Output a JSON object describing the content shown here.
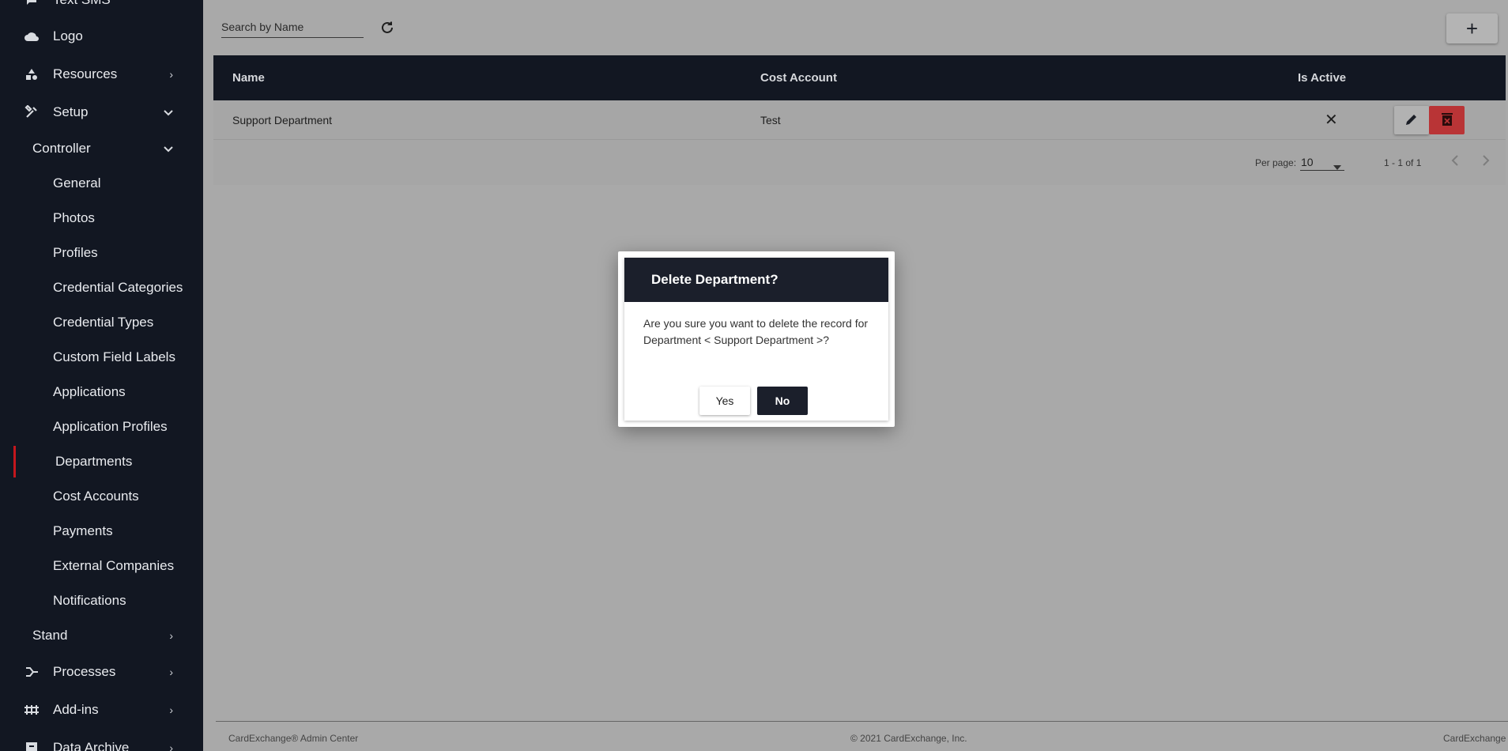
{
  "sidebar": {
    "items": [
      {
        "label": "Text SMS",
        "icon": "chat-icon"
      },
      {
        "label": "Logo",
        "icon": "cloud-icon"
      },
      {
        "label": "Resources",
        "icon": "shapes-icon",
        "chevron": "›"
      },
      {
        "label": "Setup",
        "icon": "tools-icon",
        "chevron": "⌄"
      },
      {
        "label": "Controller",
        "chevron": "⌄"
      },
      {
        "label": "General"
      },
      {
        "label": "Photos"
      },
      {
        "label": "Profiles"
      },
      {
        "label": "Credential Categories"
      },
      {
        "label": "Credential Types"
      },
      {
        "label": "Custom Field Labels"
      },
      {
        "label": "Applications"
      },
      {
        "label": "Application Profiles"
      },
      {
        "label": "Departments"
      },
      {
        "label": "Cost Accounts"
      },
      {
        "label": "Payments"
      },
      {
        "label": "External Companies"
      },
      {
        "label": "Notifications"
      },
      {
        "label": "Stand",
        "chevron": "›"
      },
      {
        "label": "Processes",
        "icon": "processes-icon",
        "chevron": "›"
      },
      {
        "label": "Add-ins",
        "icon": "addins-icon",
        "chevron": "›"
      },
      {
        "label": "Data Archive",
        "icon": "archive-icon",
        "chevron": "›"
      }
    ]
  },
  "toolbar": {
    "search_placeholder": "Search by Name",
    "add_label": "+"
  },
  "table": {
    "headers": [
      "Name",
      "Cost Account",
      "Is Active"
    ],
    "rows": [
      {
        "name": "Support Department",
        "cost_account": "Test",
        "is_active": "✕"
      }
    ]
  },
  "pager": {
    "per_page_label": "Per page:",
    "per_page_value": "10",
    "range": "1 - 1 of 1"
  },
  "footer": {
    "left": "CardExchange® Admin Center",
    "center": "© 2021 CardExchange, Inc.",
    "right": "CardExchange"
  },
  "modal": {
    "title": "Delete Department?",
    "message": "Are you sure you want to delete the record for Department < Support Department >?",
    "yes_label": "Yes",
    "no_label": "No"
  },
  "colors": {
    "sidebar_bg": "#121722",
    "active_marker": "#c4171d",
    "delete_button": "#b93436",
    "modal_header": "#1b1f2b"
  }
}
